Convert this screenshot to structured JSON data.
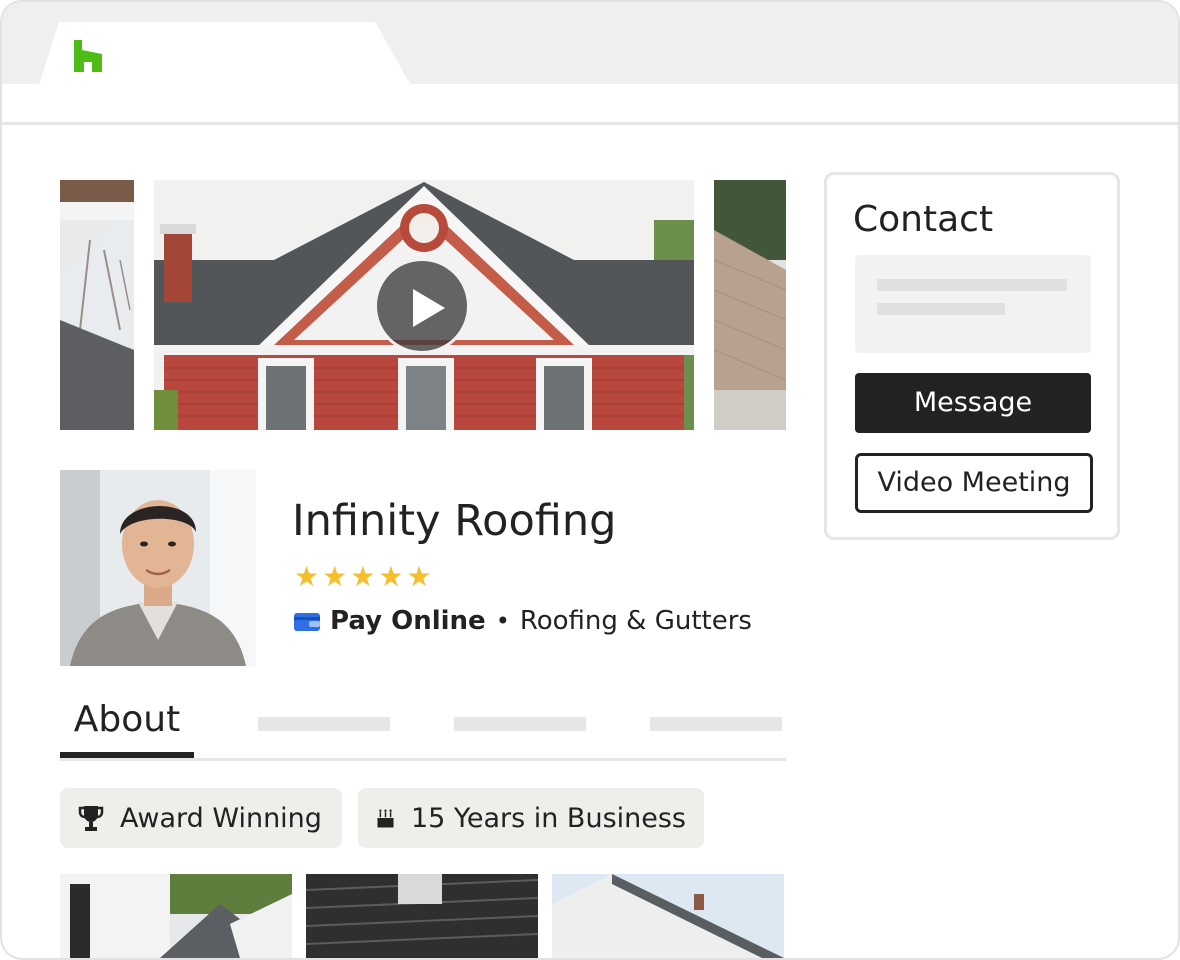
{
  "browser": {
    "logo_icon": "houzz-logo-icon",
    "logo_color": "#4dbc15"
  },
  "gallery": {
    "play_icon": "play-icon"
  },
  "profile": {
    "business_name": "Infinity Roofing",
    "rating_stars": 5,
    "star_glyph": "★★★★★",
    "payment_icon": "wallet-icon",
    "payment_label": "Pay Online",
    "separator": "•",
    "category": "Roofing & Gutters"
  },
  "tabs": {
    "active_label": "About"
  },
  "badges": [
    {
      "icon": "trophy-icon",
      "label": "Award Winning"
    },
    {
      "icon": "cake-icon",
      "label": "15 Years in Business"
    }
  ],
  "contact": {
    "title": "Contact",
    "message_button": "Message",
    "video_button": "Video Meeting"
  },
  "colors": {
    "accent_green": "#4dbc15",
    "star_yellow": "#f5be2c",
    "pay_blue": "#2f6fe6",
    "dark_button": "#222222"
  }
}
